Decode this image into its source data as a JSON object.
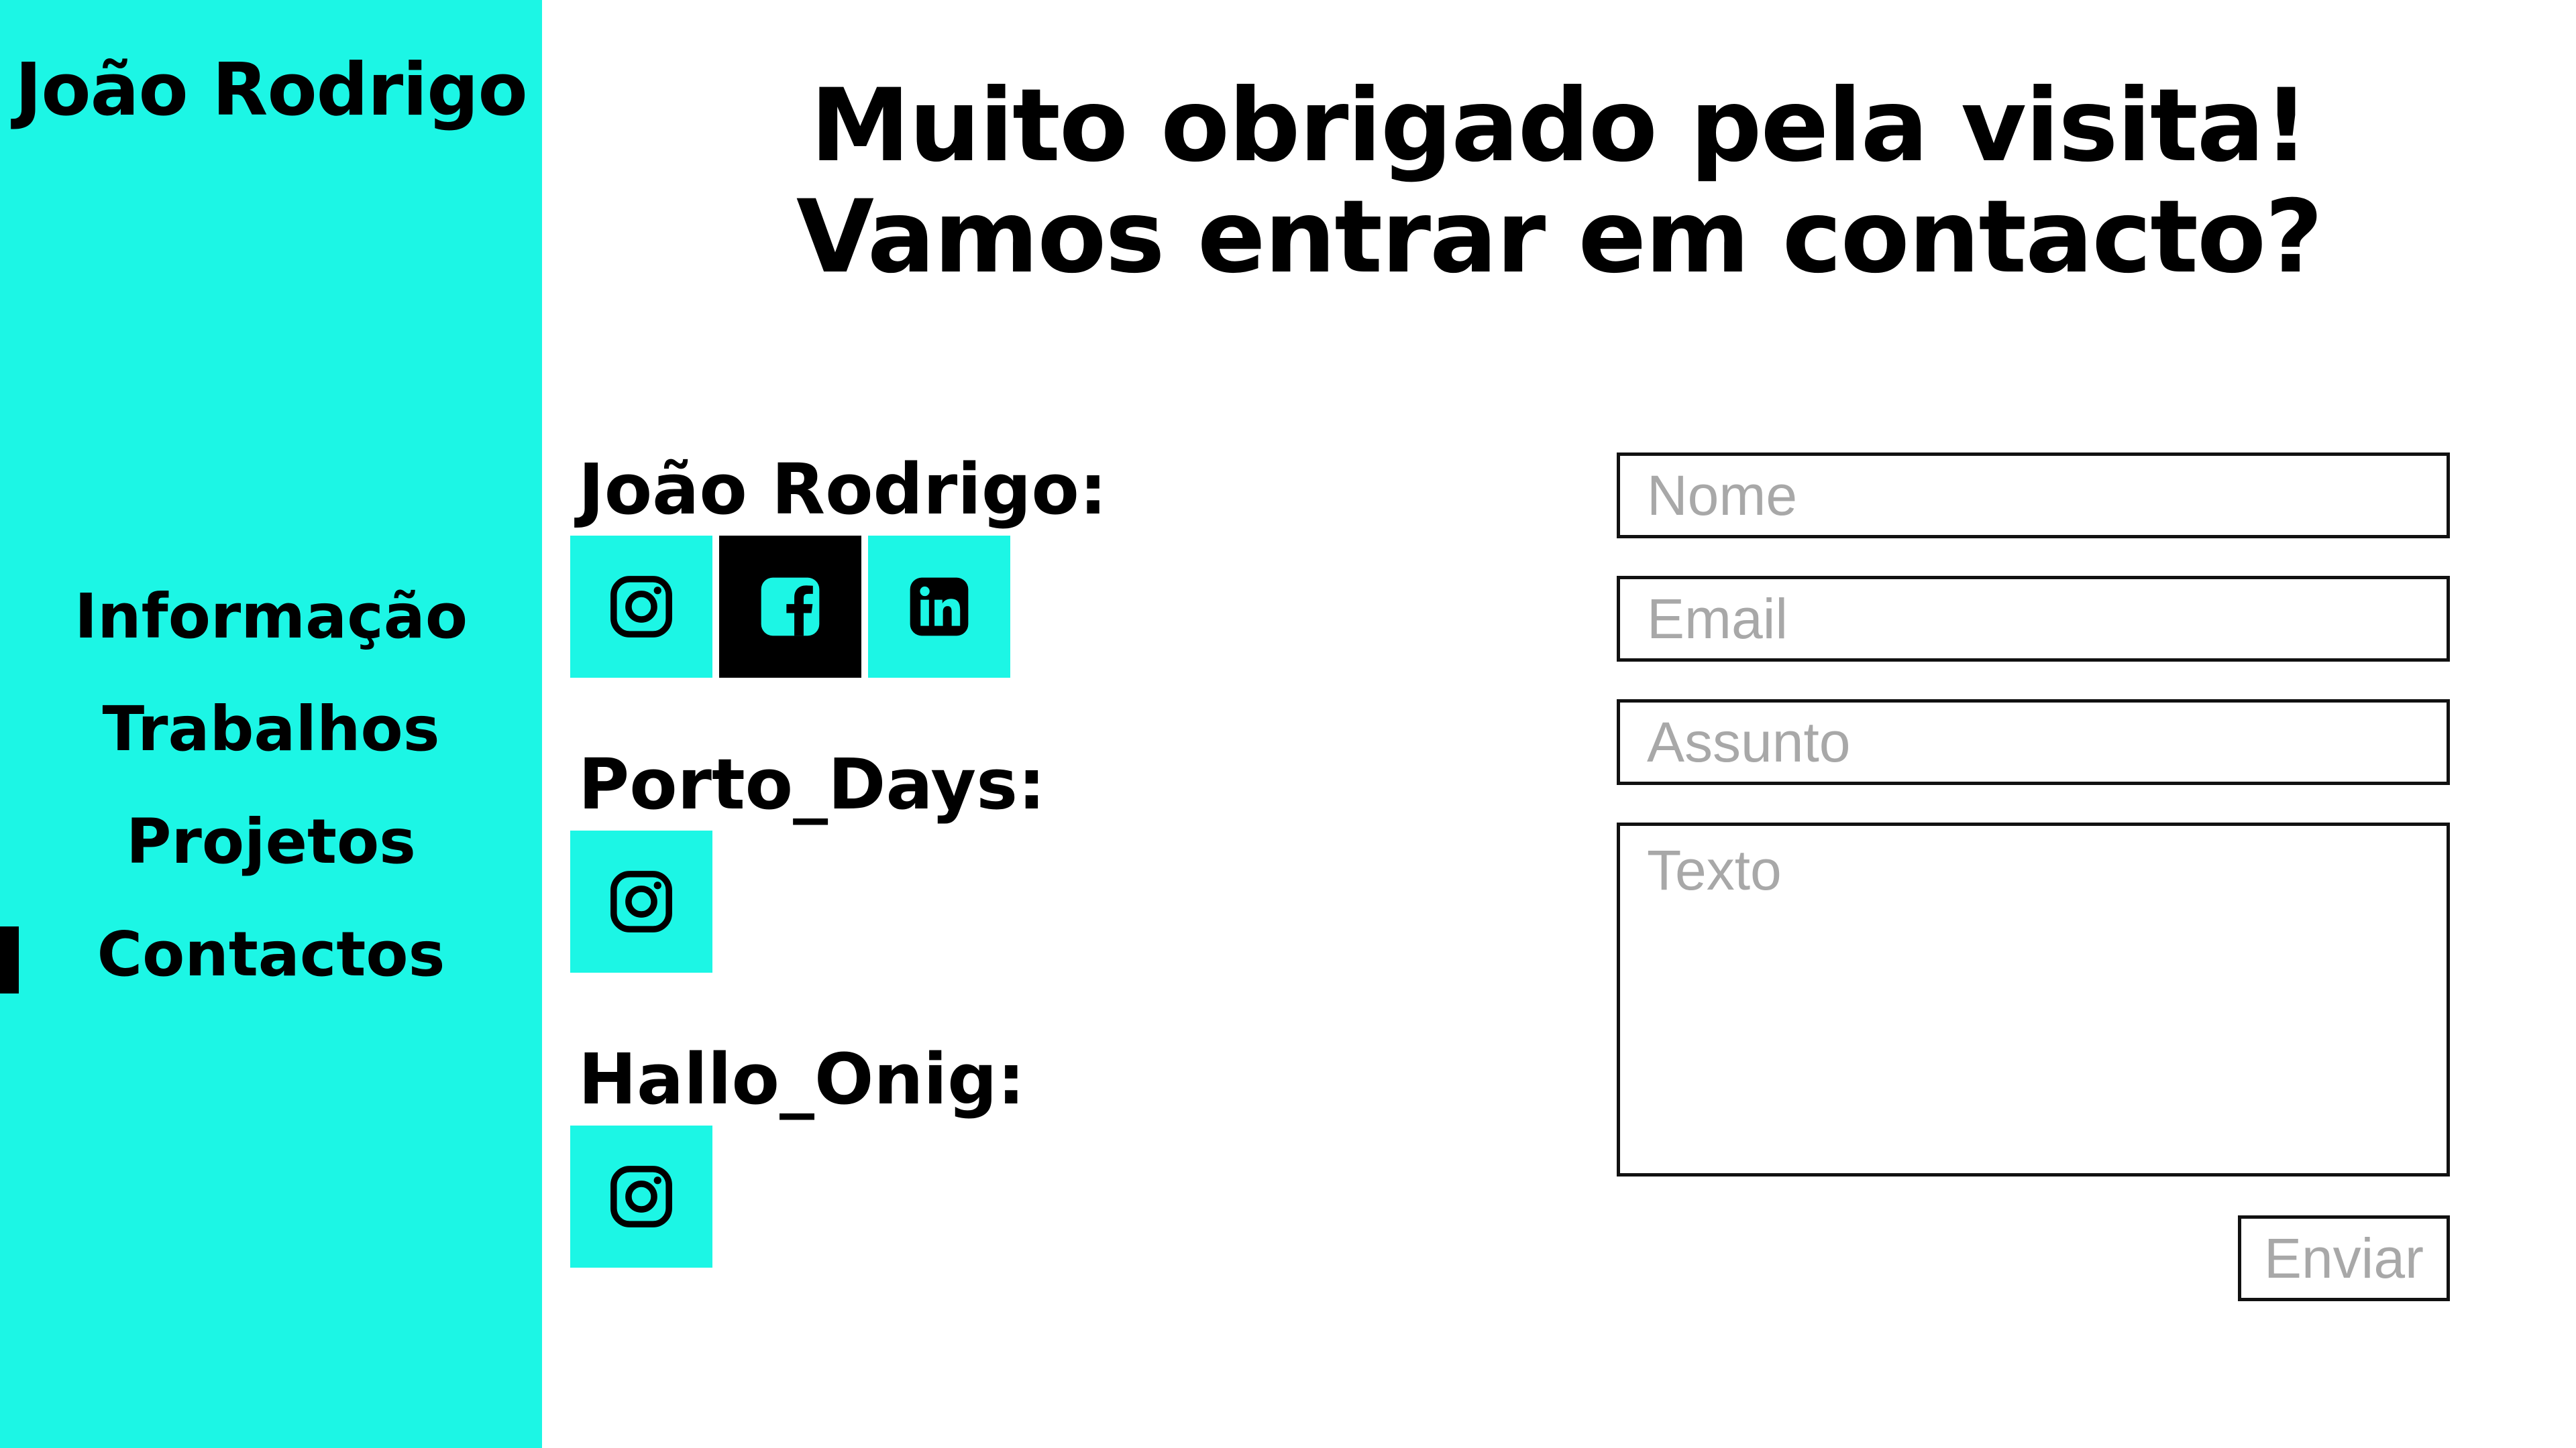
{
  "sidebar": {
    "brand": "João Rodrigo",
    "nav": [
      {
        "label": "Informação",
        "active": false
      },
      {
        "label": "Trabalhos",
        "active": false
      },
      {
        "label": "Projetos",
        "active": false
      },
      {
        "label": "Contactos",
        "active": true
      }
    ]
  },
  "main": {
    "headline": {
      "line1": "Muito obrigado pela visita!",
      "line2": "Vamos entrar em contacto?"
    },
    "contacts": [
      {
        "label": "João Rodrigo:",
        "networks": [
          "instagram-icon",
          "facebook-icon",
          "linkedin-icon"
        ]
      },
      {
        "label": "Porto_Days:",
        "networks": [
          "instagram-icon"
        ]
      },
      {
        "label": "Hallo_Onig:",
        "networks": [
          "instagram-icon"
        ]
      }
    ]
  },
  "form": {
    "name_placeholder": "Nome",
    "email_placeholder": "Email",
    "subject_placeholder": "Assunto",
    "text_placeholder": "Texto",
    "submit_label": "Enviar"
  },
  "colors": {
    "accent": "#1cf6e5",
    "text": "#000000",
    "placeholder": "#a8a8a8",
    "background": "#ffffff"
  }
}
